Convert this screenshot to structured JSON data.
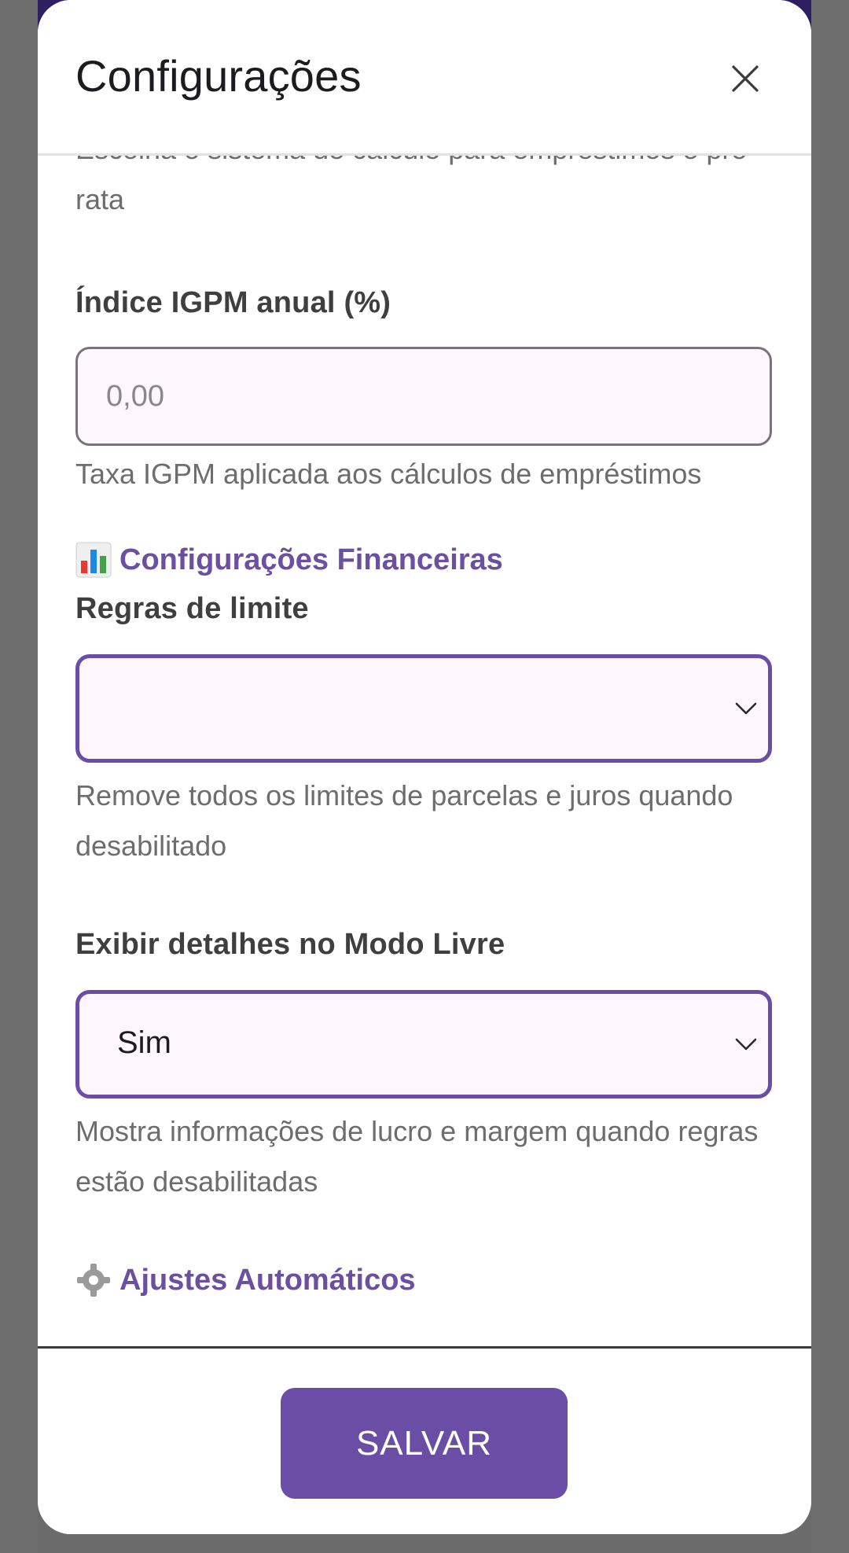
{
  "modal": {
    "title": "Configurações",
    "close_icon": "close-icon"
  },
  "calc_system": {
    "helper": "Escolha o sistema de cálculo para empréstimos e pro-rata"
  },
  "igpm": {
    "label": "Índice IGPM anual (%)",
    "placeholder": "0,00",
    "value": "",
    "helper": "Taxa IGPM aplicada aos cálculos de empréstimos"
  },
  "financial_section": {
    "icon": "bar-chart-icon",
    "title": "Configurações Financeiras"
  },
  "limit_rules": {
    "label": "Regras de limite",
    "selected": "",
    "helper": "Remove todos os limites de parcelas e juros quando desabilitado"
  },
  "free_mode_details": {
    "label": "Exibir detalhes no Modo Livre",
    "selected": "Sim",
    "helper": "Mostra informações de lucro e margem quando regras estão desabilitadas"
  },
  "auto_section": {
    "icon": "gear-icon",
    "title": "Ajustes Automáticos"
  },
  "footer": {
    "save_label": "SALVAR"
  },
  "colors": {
    "accent": "#6a4ea6",
    "field_bg": "#fdf6fd",
    "section_title": "#6b4fa0"
  }
}
